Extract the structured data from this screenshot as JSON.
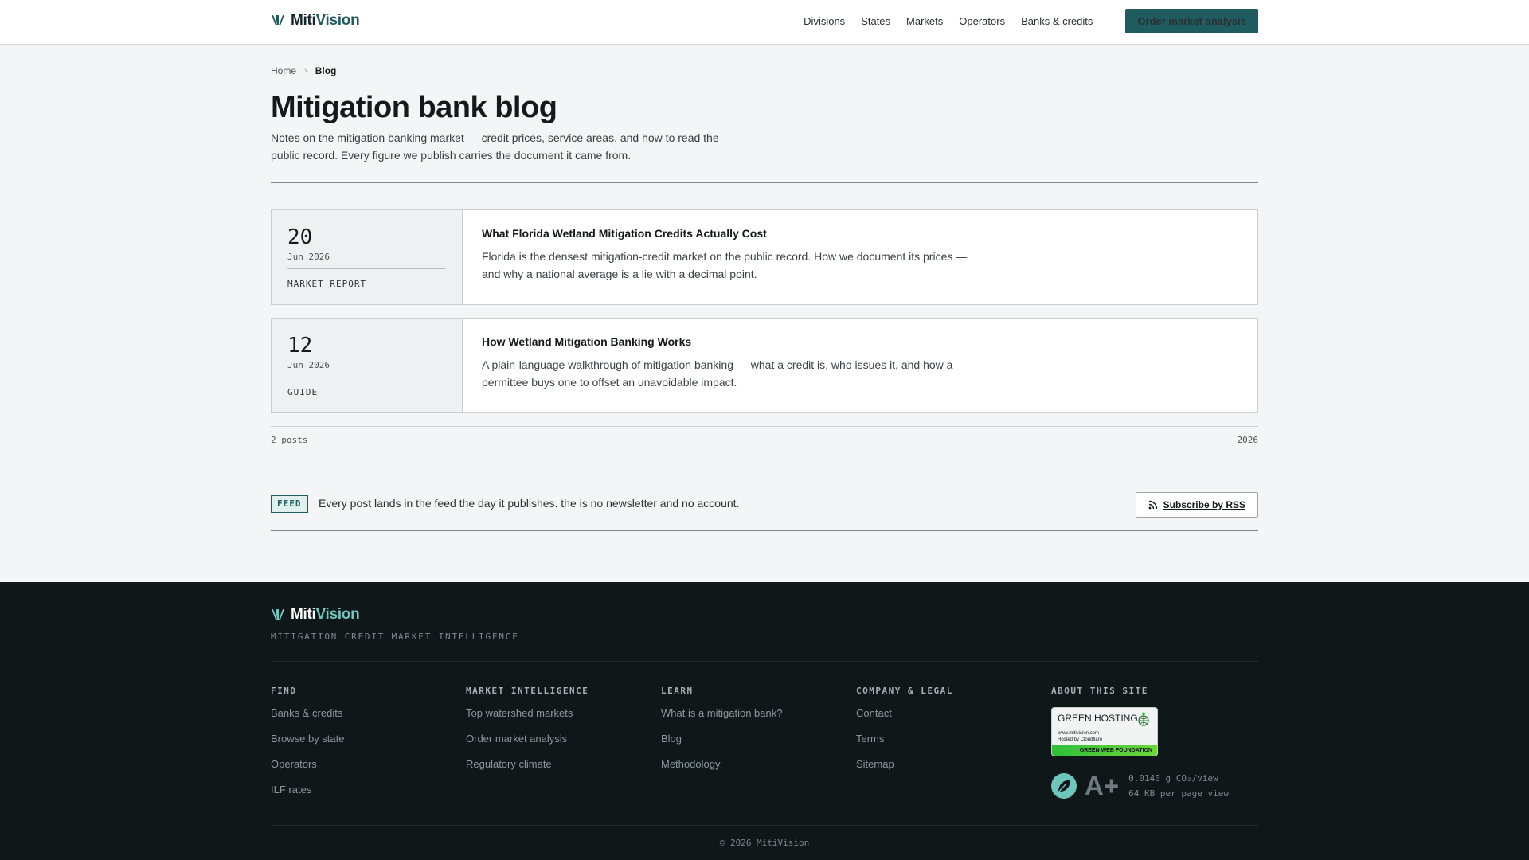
{
  "brand": {
    "name_part1": "Miti",
    "name_part2": "Vision"
  },
  "nav": {
    "items": [
      "Divisions",
      "States",
      "Markets",
      "Operators",
      "Banks & credits"
    ],
    "cta": "Order market analysis"
  },
  "breadcrumb": {
    "home": "Home",
    "current": "Blog"
  },
  "page": {
    "title": "Mitigation bank blog",
    "intro": "Notes on the mitigation banking market — credit prices, service areas, and how to read the public record. Every figure we publish carries the document it came from."
  },
  "posts": [
    {
      "day": "20",
      "month_year": "Jun 2026",
      "kind": "MARKET REPORT",
      "title": "What Florida Wetland Mitigation Credits Actually Cost",
      "excerpt": "Florida is the densest mitigation-credit market on the public record. How we document its prices — and why a national average is a lie with a decimal point."
    },
    {
      "day": "12",
      "month_year": "Jun 2026",
      "kind": "GUIDE",
      "title": "How Wetland Mitigation Banking Works",
      "excerpt": "A plain-language walkthrough of mitigation banking — what a credit is, who issues it, and how a permittee buys one to offset an unavoidable impact."
    }
  ],
  "listing": {
    "count": "2 posts",
    "year": "2026"
  },
  "feed": {
    "tag": "FEED",
    "text": "Every post lands in the feed the day it publishes. the is no newsletter and no account.",
    "button": "Subscribe by RSS"
  },
  "footer": {
    "tagline": "MITIGATION CREDIT MARKET INTELLIGENCE",
    "columns": [
      {
        "heading": "FIND",
        "links": [
          "Banks & credits",
          "Browse by state",
          "Operators",
          "ILF rates"
        ]
      },
      {
        "heading": "MARKET INTELLIGENCE",
        "links": [
          "Top watershed markets",
          "Order market analysis",
          "Regulatory climate"
        ]
      },
      {
        "heading": "LEARN",
        "links": [
          "What is a mitigation bank?",
          "Blog",
          "Methodology"
        ]
      },
      {
        "heading": "COMPANY & LEGAL",
        "links": [
          "Contact",
          "Terms",
          "Sitemap"
        ]
      },
      {
        "heading": "ABOUT THIS SITE",
        "links": []
      }
    ],
    "badge": {
      "title": "GREEN HOSTING",
      "line1": "www.mitivision.com",
      "line2": "Hosted by Cloudflare",
      "foundation": "GREEN WEB FOUNDATION"
    },
    "eco": {
      "grade": "A+",
      "co2": "0.0140 g CO₂/view",
      "weight": "64 KB per page view"
    },
    "copyright": "© 2026 MitiVision"
  },
  "colors": {
    "accent": "#1e5c5f",
    "footer_bg": "#101719",
    "footer_accent": "#6fc6bd"
  },
  "icons": {
    "logo": "leaf-mark-icon",
    "breadcrumb_sep": "chevron-right-icon",
    "rss": "rss-icon",
    "eco": "leaf-icon"
  }
}
